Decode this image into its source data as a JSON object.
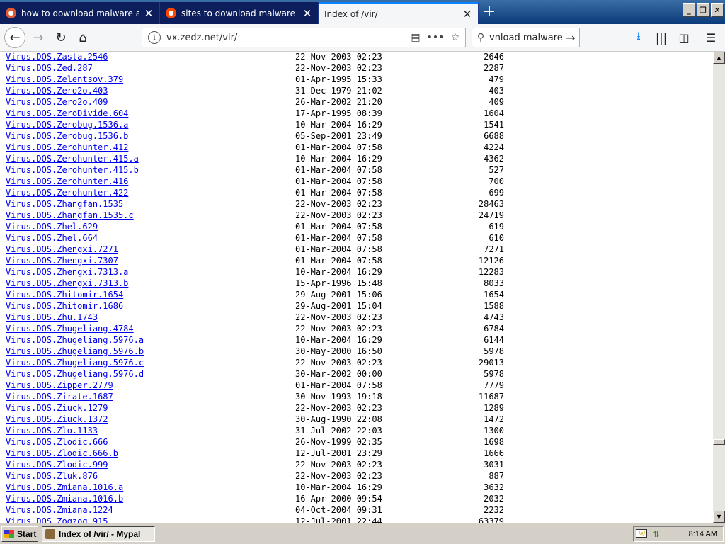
{
  "tabs": [
    {
      "title": "how to download malware at Duck",
      "icon": "duckduckgo-icon",
      "color": "#de5833"
    },
    {
      "title": "sites to download malware : Malw",
      "icon": "reddit-icon",
      "color": "#ff4500"
    },
    {
      "title": "Index of /vir/",
      "icon": "",
      "color": ""
    }
  ],
  "nav": {
    "url": "vx.zedz.net/vir/",
    "search_text": "vnload malware"
  },
  "listing": [
    {
      "name": "Virus.DOS.Zasta.2546",
      "date": "22-Nov-2003 02:23",
      "size": "2646"
    },
    {
      "name": "Virus.DOS.Zed.287",
      "date": "22-Nov-2003 02:23",
      "size": "2287"
    },
    {
      "name": "Virus.DOS.Zelentsov.379",
      "date": "01-Apr-1995 15:33",
      "size": "479"
    },
    {
      "name": "Virus.DOS.Zero2o.403",
      "date": "31-Dec-1979 21:02",
      "size": "403"
    },
    {
      "name": "Virus.DOS.Zero2o.409",
      "date": "26-Mar-2002 21:20",
      "size": "409"
    },
    {
      "name": "Virus.DOS.ZeroDivide.604",
      "date": "17-Apr-1995 08:39",
      "size": "1604"
    },
    {
      "name": "Virus.DOS.Zerobug.1536.a",
      "date": "10-Mar-2004 16:29",
      "size": "1541"
    },
    {
      "name": "Virus.DOS.Zerobug.1536.b",
      "date": "05-Sep-2001 23:49",
      "size": "6688"
    },
    {
      "name": "Virus.DOS.Zerohunter.412",
      "date": "01-Mar-2004 07:58",
      "size": "4224"
    },
    {
      "name": "Virus.DOS.Zerohunter.415.a",
      "date": "10-Mar-2004 16:29",
      "size": "4362"
    },
    {
      "name": "Virus.DOS.Zerohunter.415.b",
      "date": "01-Mar-2004 07:58",
      "size": "527"
    },
    {
      "name": "Virus.DOS.Zerohunter.416",
      "date": "01-Mar-2004 07:58",
      "size": "700"
    },
    {
      "name": "Virus.DOS.Zerohunter.422",
      "date": "01-Mar-2004 07:58",
      "size": "699"
    },
    {
      "name": "Virus.DOS.Zhangfan.1535",
      "date": "22-Nov-2003 02:23",
      "size": "28463"
    },
    {
      "name": "Virus.DOS.Zhangfan.1535.c",
      "date": "22-Nov-2003 02:23",
      "size": "24719"
    },
    {
      "name": "Virus.DOS.Zhel.629",
      "date": "01-Mar-2004 07:58",
      "size": "619"
    },
    {
      "name": "Virus.DOS.Zhel.664",
      "date": "01-Mar-2004 07:58",
      "size": "610"
    },
    {
      "name": "Virus.DOS.Zhengxi.7271",
      "date": "01-Mar-2004 07:58",
      "size": "7271"
    },
    {
      "name": "Virus.DOS.Zhengxi.7307",
      "date": "01-Mar-2004 07:58",
      "size": "12126"
    },
    {
      "name": "Virus.DOS.Zhengxi.7313.a",
      "date": "10-Mar-2004 16:29",
      "size": "12283"
    },
    {
      "name": "Virus.DOS.Zhengxi.7313.b",
      "date": "15-Apr-1996 15:48",
      "size": "8033"
    },
    {
      "name": "Virus.DOS.Zhitomir.1654",
      "date": "29-Aug-2001 15:06",
      "size": "1654"
    },
    {
      "name": "Virus.DOS.Zhitomir.1686",
      "date": "29-Aug-2001 15:04",
      "size": "1588"
    },
    {
      "name": "Virus.DOS.Zhu.1743",
      "date": "22-Nov-2003 02:23",
      "size": "4743"
    },
    {
      "name": "Virus.DOS.Zhugeliang.4784",
      "date": "22-Nov-2003 02:23",
      "size": "6784"
    },
    {
      "name": "Virus.DOS.Zhugeliang.5976.a",
      "date": "10-Mar-2004 16:29",
      "size": "6144"
    },
    {
      "name": "Virus.DOS.Zhugeliang.5976.b",
      "date": "30-May-2000 16:50",
      "size": "5978"
    },
    {
      "name": "Virus.DOS.Zhugeliang.5976.c",
      "date": "22-Nov-2003 02:23",
      "size": "29013"
    },
    {
      "name": "Virus.DOS.Zhugeliang.5976.d",
      "date": "30-Mar-2002 00:00",
      "size": "5978"
    },
    {
      "name": "Virus.DOS.Zipper.2779",
      "date": "01-Mar-2004 07:58",
      "size": "7779"
    },
    {
      "name": "Virus.DOS.Zirate.1687",
      "date": "30-Nov-1993 19:18",
      "size": "11687"
    },
    {
      "name": "Virus.DOS.Ziuck.1279",
      "date": "22-Nov-2003 02:23",
      "size": "1289"
    },
    {
      "name": "Virus.DOS.Ziuck.1372",
      "date": "30-Aug-1990 22:08",
      "size": "1472"
    },
    {
      "name": "Virus.DOS.Zlo.1133",
      "date": "31-Jul-2002 22:03",
      "size": "1300"
    },
    {
      "name": "Virus.DOS.Zlodic.666",
      "date": "26-Nov-1999 02:35",
      "size": "1698"
    },
    {
      "name": "Virus.DOS.Zlodic.666.b",
      "date": "12-Jul-2001 23:29",
      "size": "1666"
    },
    {
      "name": "Virus.DOS.Zlodic.999",
      "date": "22-Nov-2003 02:23",
      "size": "3031"
    },
    {
      "name": "Virus.DOS.Zluk.876",
      "date": "22-Nov-2003 02:23",
      "size": "887"
    },
    {
      "name": "Virus.DOS.Zmiana.1016.a",
      "date": "10-Mar-2004 16:29",
      "size": "3632"
    },
    {
      "name": "Virus.DOS.Zmiana.1016.b",
      "date": "16-Apr-2000 09:54",
      "size": "2032"
    },
    {
      "name": "Virus.DOS.Zmiana.1224",
      "date": "04-Oct-2004 09:31",
      "size": "2232"
    },
    {
      "name": "Virus.DOS.Zogzog.915",
      "date": "12-Jul-2001 22:44",
      "size": "63379"
    }
  ],
  "taskbar": {
    "start_label": "Start",
    "task_label": "Index of /vir/ - Mypal",
    "clock": "8:14 AM"
  },
  "colors": {
    "link": "#0000ee",
    "taskbar": "#d4d0c8",
    "tabstrip": "#0a3a7a"
  }
}
